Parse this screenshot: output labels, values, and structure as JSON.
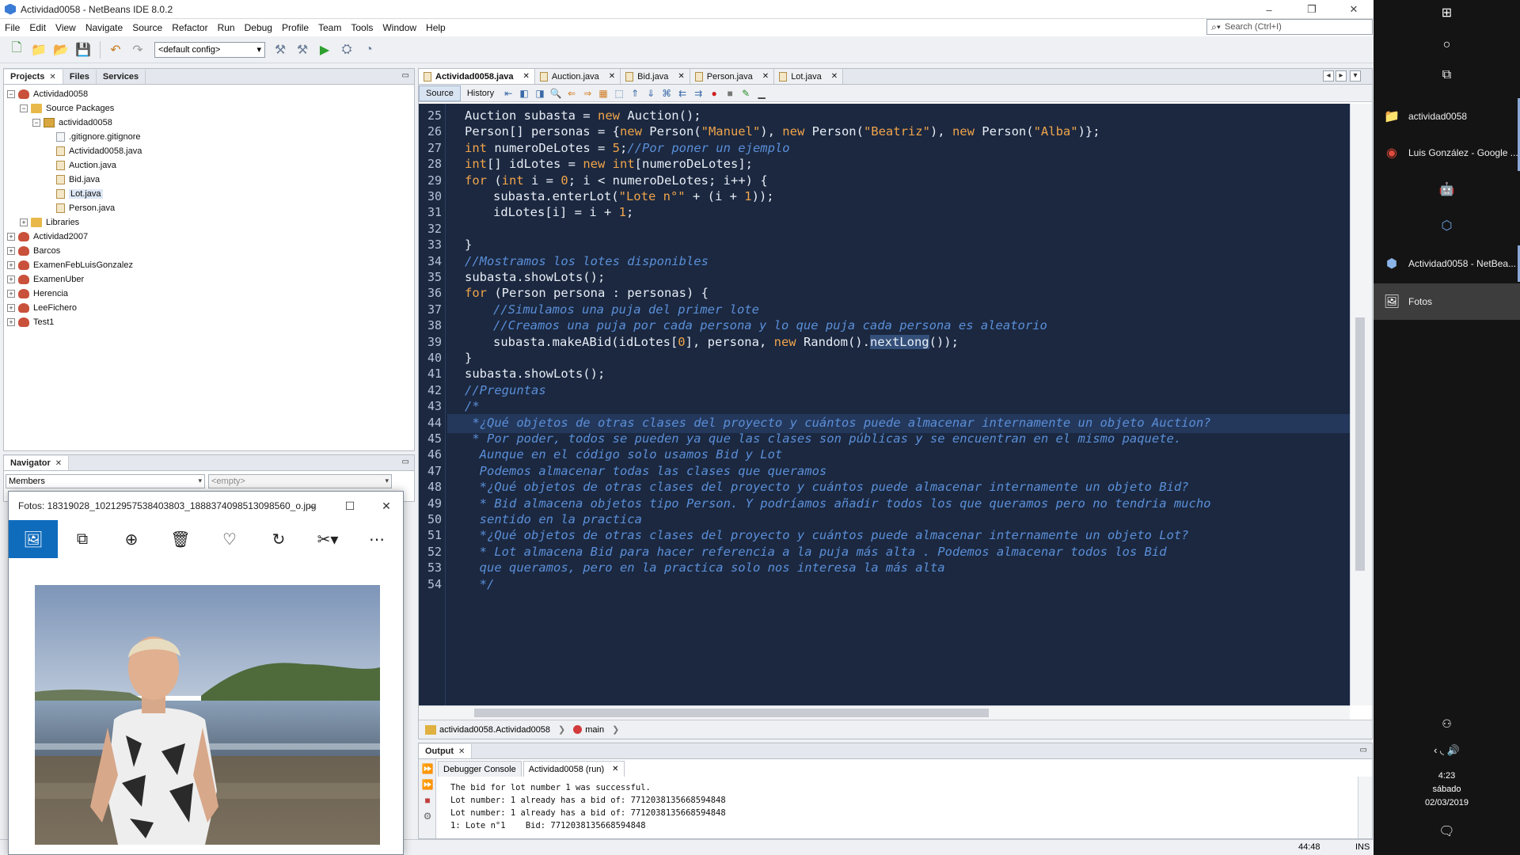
{
  "window": {
    "title": "Actividad0058 - NetBeans IDE 8.0.2",
    "menu": [
      "File",
      "Edit",
      "View",
      "Navigate",
      "Source",
      "Refactor",
      "Run",
      "Debug",
      "Profile",
      "Team",
      "Tools",
      "Window",
      "Help"
    ],
    "search_placeholder": "Search (Ctrl+I)",
    "config": "<default config>"
  },
  "projects_panel": {
    "tabs": [
      "Projects",
      "Files",
      "Services"
    ],
    "tree": [
      {
        "label": "Actividad0058",
        "icon": "project-icon",
        "toggle": "−",
        "depth": 0
      },
      {
        "label": "Source Packages",
        "icon": "folder-icon",
        "toggle": "−",
        "depth": 1
      },
      {
        "label": "actividad0058",
        "icon": "package-icon",
        "toggle": "−",
        "depth": 2
      },
      {
        "label": ".gitignore.gitignore",
        "icon": "file-icon",
        "toggle": "",
        "depth": 3
      },
      {
        "label": "Actividad0058.java",
        "icon": "java-file-icon",
        "toggle": "",
        "depth": 3
      },
      {
        "label": "Auction.java",
        "icon": "java-file-icon",
        "toggle": "",
        "depth": 3
      },
      {
        "label": "Bid.java",
        "icon": "java-file-icon",
        "toggle": "",
        "depth": 3
      },
      {
        "label": "Lot.java",
        "icon": "java-file-icon",
        "toggle": "",
        "depth": 3,
        "selected": true
      },
      {
        "label": "Person.java",
        "icon": "java-file-icon",
        "toggle": "",
        "depth": 3
      },
      {
        "label": "Libraries",
        "icon": "folder-icon",
        "toggle": "+",
        "depth": 1
      },
      {
        "label": "Actividad2007",
        "icon": "project-icon",
        "toggle": "+",
        "depth": 0
      },
      {
        "label": "Barcos",
        "icon": "project-icon",
        "toggle": "+",
        "depth": 0
      },
      {
        "label": "ExamenFebLuisGonzalez",
        "icon": "project-icon",
        "toggle": "+",
        "depth": 0
      },
      {
        "label": "ExamenUber",
        "icon": "project-icon",
        "toggle": "+",
        "depth": 0
      },
      {
        "label": "Herencia",
        "icon": "project-icon",
        "toggle": "+",
        "depth": 0
      },
      {
        "label": "LeeFichero",
        "icon": "project-icon",
        "toggle": "+",
        "depth": 0
      },
      {
        "label": "Test1",
        "icon": "project-icon",
        "toggle": "+",
        "depth": 0
      }
    ]
  },
  "navigator": {
    "title": "Navigator",
    "members": "Members",
    "filter": "<empty>"
  },
  "editor": {
    "tabs": [
      "Actividad0058.java",
      "Auction.java",
      "Bid.java",
      "Person.java",
      "Lot.java"
    ],
    "source_label": "Source",
    "history_label": "History",
    "lines": [
      {
        "n": "25",
        "indent": 0,
        "parts": [
          [
            "Auction subasta = ",
            "t"
          ],
          [
            "new",
            "k"
          ],
          [
            " Auction();",
            "t"
          ]
        ]
      },
      {
        "n": "26",
        "indent": 0,
        "parts": [
          [
            "Person[] personas = {",
            "t"
          ],
          [
            "new",
            "k"
          ],
          [
            " Person(",
            "t"
          ],
          [
            "\"Manuel\"",
            "s"
          ],
          [
            "), ",
            "t"
          ],
          [
            "new",
            "k"
          ],
          [
            " Person(",
            "t"
          ],
          [
            "\"Beatriz\"",
            "s"
          ],
          [
            "), ",
            "t"
          ],
          [
            "new",
            "k"
          ],
          [
            " Person(",
            "t"
          ],
          [
            "\"Alba\"",
            "s"
          ],
          [
            ")};",
            "t"
          ]
        ]
      },
      {
        "n": "27",
        "indent": 0,
        "parts": [
          [
            "int",
            "k"
          ],
          [
            " numeroDeLotes = ",
            "t"
          ],
          [
            "5",
            "s"
          ],
          [
            ";",
            "t"
          ],
          [
            "//Por poner un ejemplo",
            "c"
          ]
        ]
      },
      {
        "n": "28",
        "indent": 0,
        "parts": [
          [
            "int",
            "k"
          ],
          [
            "[] idLotes = ",
            "t"
          ],
          [
            "new",
            "k"
          ],
          [
            " ",
            "t"
          ],
          [
            "int",
            "k"
          ],
          [
            "[numeroDeLotes];",
            "t"
          ]
        ]
      },
      {
        "n": "29",
        "indent": 0,
        "parts": [
          [
            "for",
            "k"
          ],
          [
            " (",
            "t"
          ],
          [
            "int",
            "k"
          ],
          [
            " i = ",
            "t"
          ],
          [
            "0",
            "s"
          ],
          [
            "; i < numeroDeLotes; i++) {",
            "t"
          ]
        ]
      },
      {
        "n": "30",
        "indent": 1,
        "parts": [
          [
            "subasta.enterLot(",
            "t"
          ],
          [
            "\"Lote n°\"",
            "s"
          ],
          [
            " + (i + ",
            "t"
          ],
          [
            "1",
            "s"
          ],
          [
            "));",
            "t"
          ]
        ]
      },
      {
        "n": "31",
        "indent": 1,
        "parts": [
          [
            "idLotes[i] = i + ",
            "t"
          ],
          [
            "1",
            "s"
          ],
          [
            ";",
            "t"
          ]
        ]
      },
      {
        "n": "32",
        "indent": 0,
        "parts": []
      },
      {
        "n": "33",
        "indent": 0,
        "parts": [
          [
            "}",
            "t"
          ]
        ]
      },
      {
        "n": "34",
        "indent": 0,
        "parts": [
          [
            "//Mostramos los lotes disponibles",
            "c"
          ]
        ]
      },
      {
        "n": "35",
        "indent": 0,
        "parts": [
          [
            "subasta.showLots();",
            "t"
          ]
        ]
      },
      {
        "n": "36",
        "indent": 0,
        "parts": [
          [
            "for",
            "k"
          ],
          [
            " (Person persona : personas) {",
            "t"
          ]
        ]
      },
      {
        "n": "37",
        "indent": 1,
        "parts": [
          [
            "//Simulamos una puja del primer lote",
            "c"
          ]
        ]
      },
      {
        "n": "38",
        "indent": 1,
        "parts": [
          [
            "//Creamos una puja por cada persona y lo que puja cada persona es aleatorio",
            "c"
          ]
        ]
      },
      {
        "n": "39",
        "indent": 1,
        "parts": [
          [
            "subasta.makeABid(idLotes[",
            "t"
          ],
          [
            "0",
            "s"
          ],
          [
            "], persona, ",
            "t"
          ],
          [
            "new",
            "k"
          ],
          [
            " Random().",
            "t"
          ],
          [
            "nextLong",
            "m"
          ],
          [
            "());",
            "t"
          ]
        ]
      },
      {
        "n": "40",
        "indent": 0,
        "parts": [
          [
            "}",
            "t"
          ]
        ]
      },
      {
        "n": "41",
        "indent": 0,
        "parts": [
          [
            "subasta.showLots();",
            "t"
          ]
        ]
      },
      {
        "n": "42",
        "indent": 0,
        "parts": [
          [
            "//Preguntas",
            "c"
          ]
        ]
      },
      {
        "n": "43",
        "indent": 0,
        "parts": [
          [
            "/*",
            "c"
          ]
        ]
      },
      {
        "n": "44",
        "indent": 0,
        "highlight": true,
        "parts": [
          [
            " *¿Qué objetos de otras clases del proyecto y cuántos puede almacenar internamente un objeto Auction?",
            "c"
          ]
        ]
      },
      {
        "n": "45",
        "indent": 0,
        "parts": [
          [
            " * Por poder, todos se pueden ya que las clases son públicas y se encuentran en el mismo paquete.",
            "c"
          ]
        ]
      },
      {
        "n": "46",
        "indent": 0,
        "parts": [
          [
            "  Aunque en el código solo usamos Bid y Lot",
            "c"
          ]
        ]
      },
      {
        "n": "47",
        "indent": 0,
        "parts": [
          [
            "  Podemos almacenar todas las clases que queramos",
            "c"
          ]
        ]
      },
      {
        "n": "48",
        "indent": 0,
        "parts": [
          [
            "  *¿Qué objetos de otras clases del proyecto y cuántos puede almacenar internamente un objeto Bid?",
            "c"
          ]
        ]
      },
      {
        "n": "49",
        "indent": 0,
        "parts": [
          [
            "  * Bid almacena objetos tipo Person. Y podríamos añadir todos los que queramos pero no tendria mucho",
            "c"
          ]
        ]
      },
      {
        "n": "50",
        "indent": 0,
        "parts": [
          [
            "  sentido en la practica",
            "c"
          ]
        ]
      },
      {
        "n": "51",
        "indent": 0,
        "parts": [
          [
            "  *¿Qué objetos de otras clases del proyecto y cuántos puede almacenar internamente un objeto Lot?",
            "c"
          ]
        ]
      },
      {
        "n": "52",
        "indent": 0,
        "parts": [
          [
            "  * Lot almacena Bid para hacer referencia a la puja más alta . Podemos almacenar todos los Bid",
            "c"
          ]
        ]
      },
      {
        "n": "53",
        "indent": 0,
        "parts": [
          [
            "  que queramos, pero en la practica solo nos interesa la más alta",
            "c"
          ]
        ]
      },
      {
        "n": "54",
        "indent": 0,
        "parts": [
          [
            "  */",
            "c"
          ]
        ]
      }
    ],
    "colors": {
      "t": "#e8edf5",
      "k": "#f0a44a",
      "s": "#f0a44a",
      "c": "#5b8fd8",
      "m": "#e8edf5"
    },
    "breadcrumb": [
      "actividad0058.Actividad0058",
      "main"
    ]
  },
  "output": {
    "title": "Output",
    "tabs": [
      "Debugger Console",
      "Actividad0058 (run)"
    ],
    "lines": [
      "The bid for lot number 1 was successful.",
      "Lot number: 1 already has a bid of: 7712038135668594848",
      "Lot number: 1 already has a bid of: 7712038135668594848",
      "1: Lote n°1    Bid: 7712038135668594848"
    ]
  },
  "status": {
    "position": "44:48",
    "mode": "INS"
  },
  "photos": {
    "title": "Fotos: 18319028_10212957538403803_1888374098513098560_o.jpg"
  },
  "taskbar": {
    "items": [
      {
        "label": "actividad0058",
        "icon": "folder-icon"
      },
      {
        "label": "Luis González - Google ...",
        "icon": "chrome-icon"
      },
      {
        "label": "",
        "icon": "android-studio-icon"
      },
      {
        "label": "",
        "icon": "virtualbox-icon"
      },
      {
        "label": "Actividad0058 - NetBea...",
        "icon": "netbeans-icon"
      },
      {
        "label": "Fotos",
        "icon": "photos-icon",
        "active": true
      }
    ],
    "time": "4:23",
    "day": "sábado",
    "date": "02/03/2019"
  }
}
